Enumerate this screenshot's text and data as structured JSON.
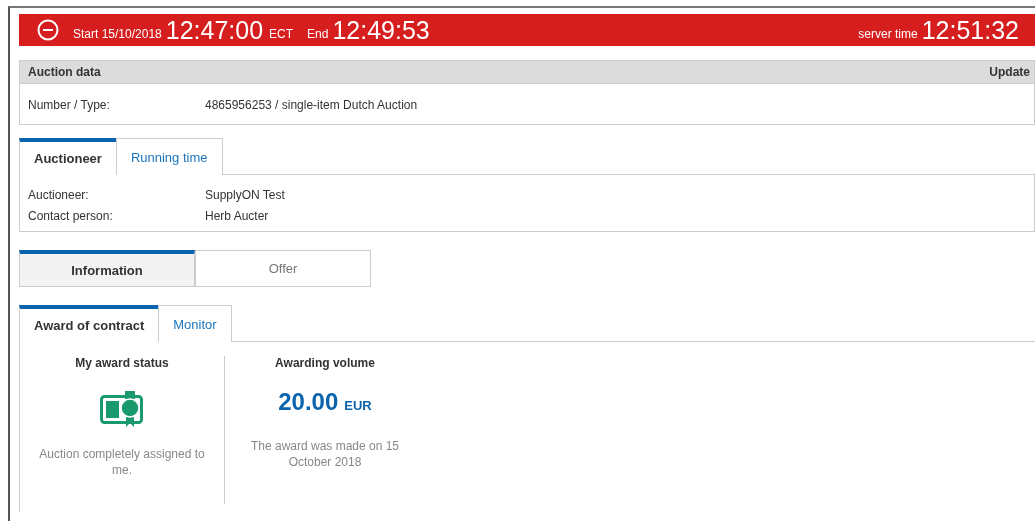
{
  "header": {
    "start_label": "Start 15/10/2018",
    "start_time": "12:47:00",
    "zone": "ECT",
    "end_label": "End",
    "end_time": "12:49:53",
    "server_label": "server time",
    "server_time": "12:51:32"
  },
  "auction_data": {
    "title": "Auction data",
    "action": "Update",
    "rows": [
      {
        "label": "Number / Type:",
        "value": "4865956253 / single-item Dutch Auction"
      }
    ]
  },
  "party_tabs": [
    {
      "label": "Auctioneer",
      "selected": true
    },
    {
      "label": "Running time",
      "selected": false
    }
  ],
  "party_rows": [
    {
      "label": "Auctioneer:",
      "value": "SupplyON Test"
    },
    {
      "label": "Contact person:",
      "value": "Herb Aucter"
    }
  ],
  "view_toggle": [
    {
      "label": "Information",
      "selected": true
    },
    {
      "label": "Offer",
      "selected": false
    }
  ],
  "result_tabs": [
    {
      "label": "Award of contract",
      "selected": true
    },
    {
      "label": "Monitor",
      "selected": false
    }
  ],
  "award_status": {
    "title": "My award status",
    "text": "Auction completely assigned to me."
  },
  "awarding_volume": {
    "title": "Awarding volume",
    "amount": "20.00",
    "currency": "EUR",
    "text": "The award was made on 15 October 2018"
  }
}
